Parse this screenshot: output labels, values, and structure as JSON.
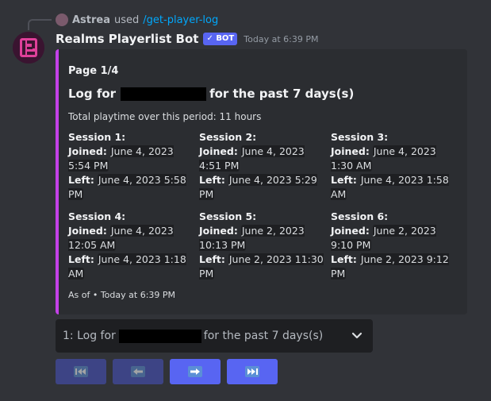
{
  "reply": {
    "user": "Astrea",
    "used": "used",
    "command": "/get-player-log"
  },
  "message": {
    "bot_name": "Realms Playerlist Bot",
    "bot_tag": "BOT",
    "timestamp": "Today at 6:39 PM"
  },
  "embed": {
    "accent_color": "#c341e8",
    "author": "Page 1/4",
    "title_prefix": "Log for",
    "title_suffix": "for the past 7 days(s)",
    "description": "Total playtime over this period: 11 hours",
    "joined_label": "Joined:",
    "left_label": "Left:",
    "sessions": [
      {
        "name": "Session 1:",
        "joined": "June 4, 2023 5:54 PM",
        "left": "June 4, 2023 5:58 PM"
      },
      {
        "name": "Session 2:",
        "joined": "June 4, 2023 4:51 PM",
        "left": "June 4, 2023 5:29 PM"
      },
      {
        "name": "Session 3:",
        "joined": "June 4, 2023 1:30 AM",
        "left": "June 4, 2023 1:58 AM"
      },
      {
        "name": "Session 4:",
        "joined": "June 4, 2023 12:05 AM",
        "left": "June 4, 2023 1:18 AM"
      },
      {
        "name": "Session 5:",
        "joined": "June 2, 2023 10:13 PM",
        "left": "June 2, 2023 11:30 PM"
      },
      {
        "name": "Session 6:",
        "joined": "June 2, 2023 9:10 PM",
        "left": "June 2, 2023 9:12 PM"
      }
    ],
    "footer": "As of • Today at 6:39 PM"
  },
  "select": {
    "prefix": "1: Log for",
    "suffix": "for the past 7 days(s)",
    "icon": "chevron-down-icon"
  },
  "buttons": [
    {
      "name": "first-page-button",
      "icon": "double-arrow-left-icon",
      "enabled": false
    },
    {
      "name": "previous-page-button",
      "icon": "arrow-left-icon",
      "enabled": false
    },
    {
      "name": "next-page-button",
      "icon": "arrow-right-icon",
      "enabled": true
    },
    {
      "name": "last-page-button",
      "icon": "double-arrow-right-icon",
      "enabled": true
    }
  ],
  "colors": {
    "background": "#313338",
    "embed_bg": "#2b2d31",
    "blurple": "#5865f2",
    "link": "#00a8fc"
  }
}
